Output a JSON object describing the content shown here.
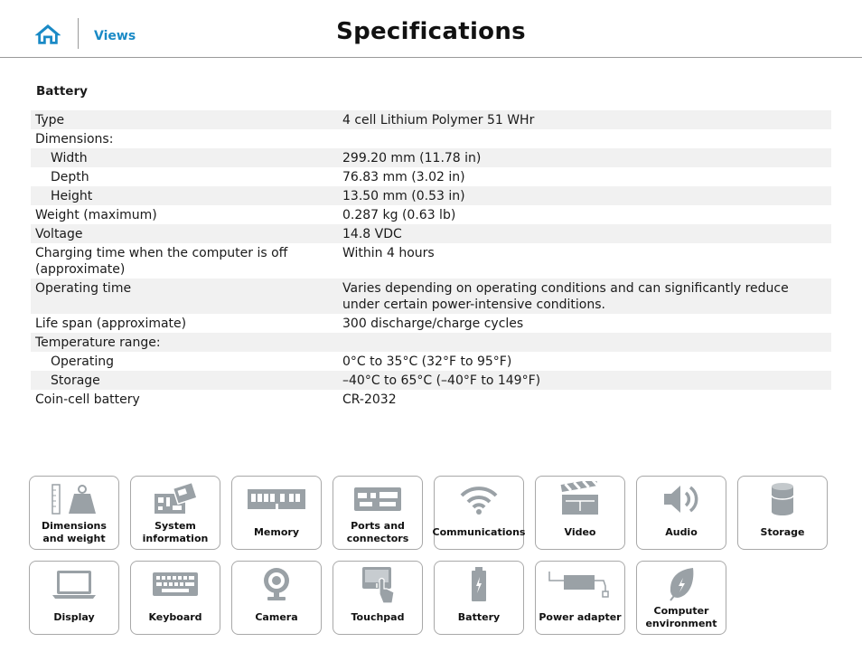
{
  "header": {
    "views_label": "Views",
    "title": "Specifications"
  },
  "section": {
    "title": "Battery"
  },
  "specs": [
    {
      "label": "Type",
      "value": "4 cell Lithium Polymer 51 WHr"
    },
    {
      "label": "Dimensions:",
      "value": ""
    },
    {
      "label": "Width",
      "value": "299.20 mm (11.78 in)"
    },
    {
      "label": "Depth",
      "value": "76.83 mm (3.02 in)"
    },
    {
      "label": "Height",
      "value": "13.50 mm (0.53 in)"
    },
    {
      "label": "Weight (maximum)",
      "value": "0.287 kg (0.63 lb)"
    },
    {
      "label": "Voltage",
      "value": "14.8 VDC"
    },
    {
      "label": "Charging time when the computer is off (approximate)",
      "value": "Within 4 hours"
    },
    {
      "label": "Operating time",
      "value": "Varies depending on operating conditions and can significantly reduce under certain power-intensive conditions."
    },
    {
      "label": "Life span (approximate)",
      "value": "300 discharge/charge cycles"
    },
    {
      "label": "Temperature range:",
      "value": ""
    },
    {
      "label": "Operating",
      "value": "0°C to 35°C (32°F to 95°F)"
    },
    {
      "label": "Storage",
      "value": "–40°C to 65°C (–40°F to 149°F)"
    },
    {
      "label": "Coin-cell battery",
      "value": "CR-2032"
    }
  ],
  "tiles": [
    {
      "label": "Dimensions and weight",
      "icon": "weight-icon"
    },
    {
      "label": "System information",
      "icon": "motherboard-icon"
    },
    {
      "label": "Memory",
      "icon": "memory-icon"
    },
    {
      "label": "Ports and connectors",
      "icon": "ports-icon"
    },
    {
      "label": "Communications",
      "icon": "wifi-icon"
    },
    {
      "label": "Video",
      "icon": "clapperboard-icon"
    },
    {
      "label": "Audio",
      "icon": "speaker-icon"
    },
    {
      "label": "Storage",
      "icon": "storage-icon"
    },
    {
      "label": "Display",
      "icon": "laptop-icon"
    },
    {
      "label": "Keyboard",
      "icon": "keyboard-icon"
    },
    {
      "label": "Camera",
      "icon": "webcam-icon"
    },
    {
      "label": "Touchpad",
      "icon": "touchpad-icon"
    },
    {
      "label": "Battery",
      "icon": "battery-icon"
    },
    {
      "label": "Power adapter",
      "icon": "power-adapter-icon"
    },
    {
      "label": "Computer environment",
      "icon": "leaf-icon"
    }
  ],
  "colors": {
    "accent": "#1a8ac6",
    "row_stripe": "#f1f1f1",
    "tile_border": "#a8a8a8",
    "icon_gray": "#9aa1a6"
  }
}
